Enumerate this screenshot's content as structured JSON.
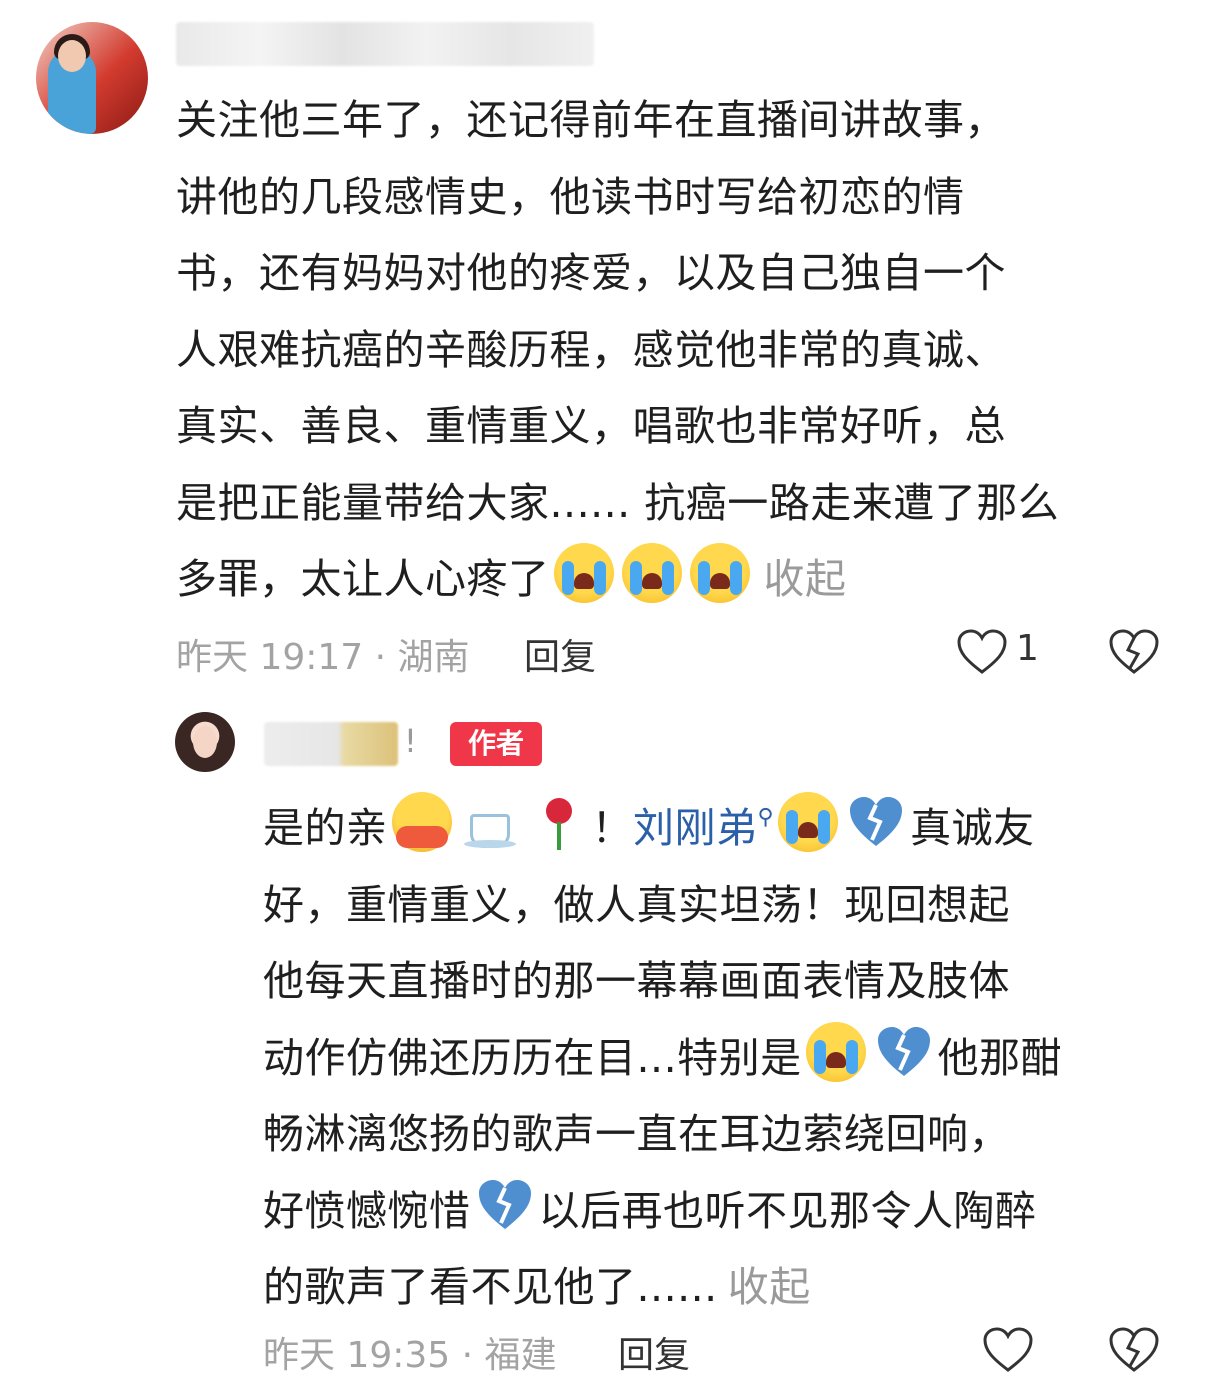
{
  "comment_main": {
    "text_lines": [
      "关注他三年了，还记得前年在直播间讲故事，",
      "讲他的几段感情史，他读书时写给初恋的情",
      "书，还有妈妈对他的疼爱，以及自己独自一个",
      "人艰难抗癌的辛酸历程，感觉他非常的真诚、",
      "真实、善良、重情重义，唱歌也非常好听，总",
      "是把正能量带给大家...... 抗癌一路走来遭了那么",
      "多罪，太让人心疼了"
    ],
    "collapse_label": "收起",
    "meta": "昨天 19:17 · 湖南",
    "reply_label": "回复",
    "like_count": "1"
  },
  "comment_reply": {
    "exclaim": "!",
    "author_badge": "作者",
    "line1_prefix": "是的亲",
    "line1_bang": "！",
    "mention": "刘刚弟",
    "mention_icon": "search-icon",
    "line1_suffix": "真诚友",
    "line2": "好，重情重义，做人真实坦荡！现回想起",
    "line3": "他每天直播时的那一幕幕画面表情及肢体",
    "line4_prefix": "动作仿佛还历历在目...特别是",
    "line4_suffix": "他那酣",
    "line5": "畅淋漓悠扬的歌声一直在耳边萦绕回响，",
    "line6_prefix": "好愤憾惋惜",
    "line6_suffix": "以后再也听不见那令人陶醉",
    "line7": "的歌声了看不见他了......",
    "collapse_label": "收起",
    "meta": "昨天 19:35 · 福建",
    "reply_label": "回复"
  },
  "icons": {
    "cry": "loudly-crying-face-icon",
    "broken_heart": "broken-heart-icon",
    "hug": "hugging-face-icon",
    "coffee": "hot-beverage-icon",
    "rose": "rose-icon",
    "like": "heart-outline-icon",
    "dislike": "broken-heart-outline-icon"
  },
  "colors": {
    "badge": "#f0374a",
    "mention": "#2b5fa8",
    "meta": "#a3a3a3"
  }
}
